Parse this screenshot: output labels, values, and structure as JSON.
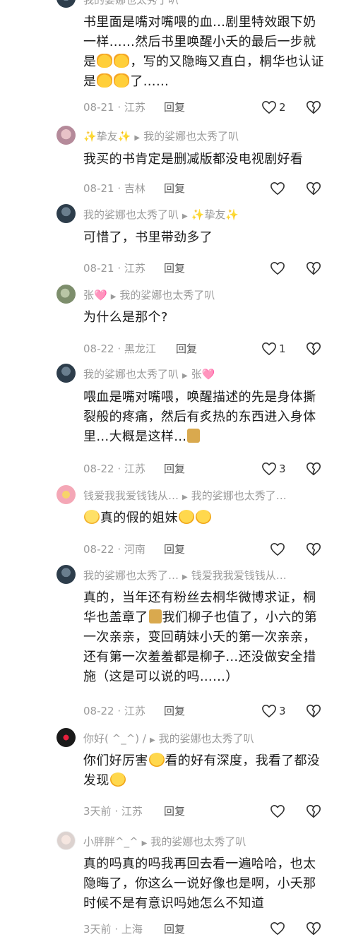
{
  "comments": [
    {
      "header_name": "我的娑娜也太秀了叭",
      "reply_to": "",
      "text_parts": [
        "书里面是嘴对嘴喂的血…剧里特效跟下奶一样……然后书里唤醒小夭的最后一步就是",
        "，写的又隐晦又直白，桐华也认证是",
        "了……"
      ],
      "date": "08-21",
      "location": "江苏",
      "reply_label": "回复",
      "likes": "2"
    },
    {
      "header_name": "✨挚友✨",
      "reply_to": "我的娑娜也太秀了叭",
      "text": "我买的书肯定是删减版都没电视剧好看",
      "date": "08-21",
      "location": "吉林",
      "reply_label": "回复",
      "likes": ""
    },
    {
      "header_name": "我的娑娜也太秀了叭",
      "reply_to": "✨挚友✨",
      "text": "可惜了，书里带劲多了",
      "date": "08-21",
      "location": "江苏",
      "reply_label": "回复",
      "likes": ""
    },
    {
      "header_name": "张🩷",
      "reply_to": "我的娑娜也太秀了叭",
      "text": "为什么是那个?",
      "date": "08-22",
      "location": "黑龙江",
      "reply_label": "回复",
      "likes": "1"
    },
    {
      "header_name": "我的娑娜也太秀了叭",
      "reply_to": "张🩷",
      "text": "喂血是嘴对嘴喂，唤醒描述的先是身体撕裂般的疼痛，然后有炙热的东西进入身体里…大概是这样…",
      "date": "08-22",
      "location": "江苏",
      "reply_label": "回复",
      "likes": "3"
    },
    {
      "header_name": "钱爱我我爱钱钱从…",
      "reply_to": "我的娑娜也太秀了…",
      "text": "真的假的姐妹",
      "date": "08-22",
      "location": "河南",
      "reply_label": "回复",
      "likes": ""
    },
    {
      "header_name": "我的娑娜也太秀了…",
      "reply_to": "钱爱我我爱钱钱从…",
      "text_parts": [
        "真的，当年还有粉丝去桐华微博求证，桐华也盖章了",
        "我们柳子也值了，小六的第一次亲亲，变回萌妹小夭的第一次亲亲，还有第一次羞羞都是柳子…还没做安全措施（这是可以说的吗……）"
      ],
      "date": "08-22",
      "location": "江苏",
      "reply_label": "回复",
      "likes": "3"
    },
    {
      "header_name": "你好( ^_^) /",
      "reply_to": "我的娑娜也太秀了叭",
      "text_parts": [
        "你们好厉害",
        "看的好有深度，我看了都没发现"
      ],
      "date": "3天前",
      "location": "江苏",
      "reply_label": "回复",
      "likes": ""
    },
    {
      "header_name": "小胖胖^_^",
      "reply_to": "我的娑娜也太秀了叭",
      "text": "真的吗真的吗我再回去看一遍哈哈，也太隐晦了，你这么一说好像也是啊，小夭那时候不是有意识吗她怎么不知道",
      "date": "3天前",
      "location": "上海",
      "reply_label": "回复",
      "likes": ""
    }
  ],
  "icons": {
    "like": "heart-outline-icon",
    "dislike": "broken-heart-icon",
    "reply_arrow": "triangle-right-icon",
    "emoji_clap": "clap-emoji-icon",
    "emoji_laugh": "laugh-cry-emoji-icon",
    "emoji_shock": "shock-emoji-icon",
    "emoji_cat": "cat-sticker-icon"
  },
  "colors": {
    "meta_gray": "#9b9b9b",
    "text": "#1b1b1b"
  }
}
